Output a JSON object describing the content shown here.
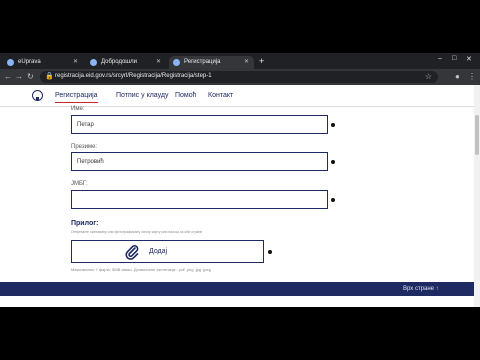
{
  "browser": {
    "tabs": [
      {
        "label": "eUprava"
      },
      {
        "label": "Добродошли"
      },
      {
        "label": "Регистрација"
      }
    ],
    "url": "registracija.eid.gov.rs/srcyrl/Registracija/Registracija/step-1"
  },
  "site": {
    "nav": [
      "Регистрација",
      "Потпис у клауду",
      "Помоћ",
      "Контакт"
    ]
  },
  "form": {
    "first_name_label": "Име:",
    "first_name_value": "Петар",
    "last_name_label": "Презиме:",
    "last_name_value": "Петровић",
    "jmbg_label": "ЈМБГ:",
    "jmbg_value": "",
    "attachment_title": "Прилог:",
    "attachment_hint": "Отпремите скенирану или фотографисану личну карту или пасош са обе стране",
    "upload_label": "Додај",
    "formats_hint": "Максимално 7 фајла, 5MB свако. Дозвољене екстензије: .pdf .png .jpg .jpeg"
  },
  "footer": {
    "link": "Врх стране ↑"
  }
}
